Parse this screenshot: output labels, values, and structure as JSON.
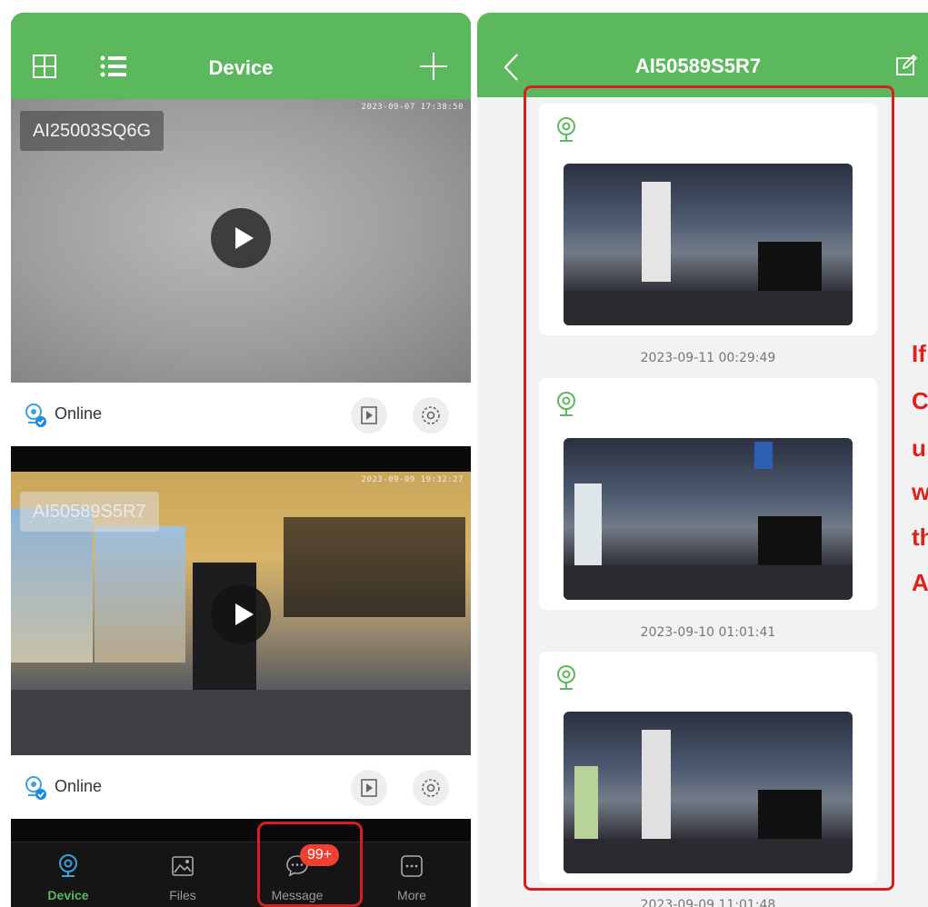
{
  "left_screen": {
    "header": {
      "title": "Device"
    },
    "cameras": [
      {
        "name": "AI25003SQ6G",
        "timestamp": "2023-09-07 17:38:50",
        "status": "Online"
      },
      {
        "name": "AI50589S5R7",
        "timestamp": "2023-09-09 19:32:27",
        "status": "Online"
      }
    ],
    "tabbar": {
      "tabs": [
        {
          "label": "Device",
          "icon": "camera-icon",
          "active": true
        },
        {
          "label": "Files",
          "icon": "image-icon"
        },
        {
          "label": "Message",
          "icon": "chat-bubble-icon",
          "badge": "99+"
        },
        {
          "label": "More",
          "icon": "more-dots-icon"
        }
      ]
    }
  },
  "right_screen": {
    "header": {
      "title": "AI50589S5R7"
    },
    "messages": [
      {
        "time": "2023-09-11 00:29:49"
      },
      {
        "time": "2023-09-10 01:01:41"
      },
      {
        "time": "2023-09-09 11:01:48"
      }
    ]
  },
  "annotation": {
    "fragments": [
      "If",
      "C",
      "u",
      "w",
      "th",
      "A"
    ]
  },
  "colors": {
    "brand_green": "#5cb85c",
    "highlight_red": "#d42020",
    "badge_red": "#ef4033"
  }
}
